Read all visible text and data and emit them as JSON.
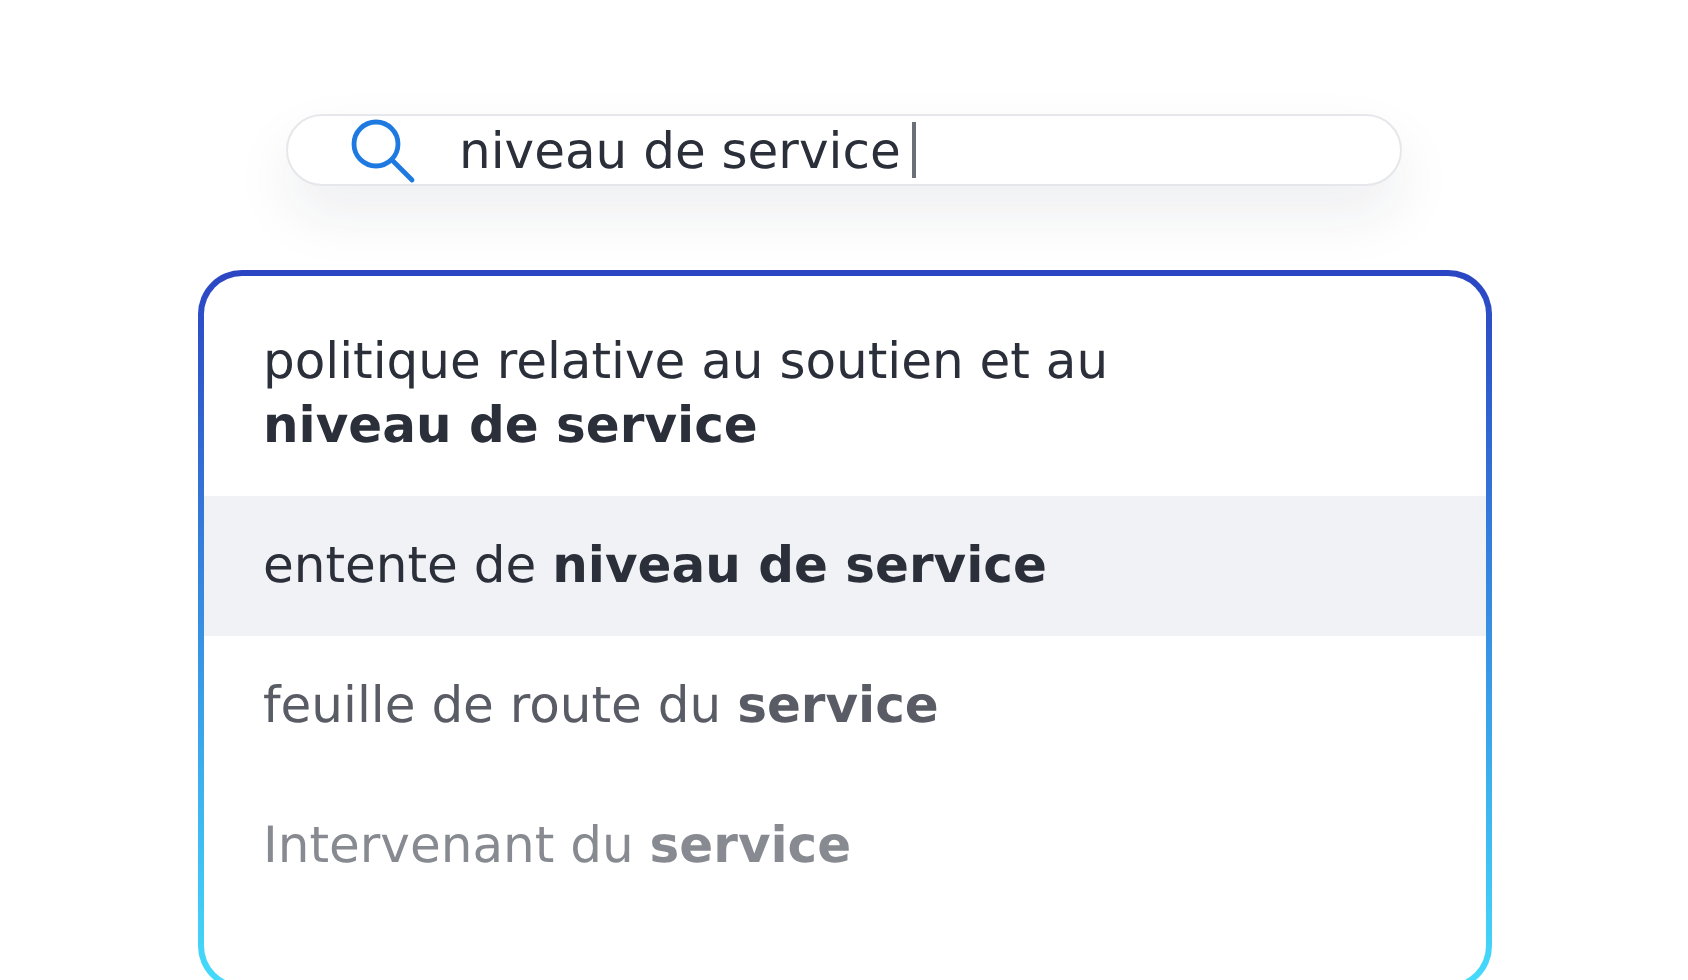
{
  "search": {
    "value": "niveau de service"
  },
  "suggestions": [
    {
      "text": "politique relative au soutien et au **niveau de service**",
      "selected": false
    },
    {
      "text": "entente de **niveau de service**",
      "selected": true
    },
    {
      "text": "feuille de route du **service**",
      "selected": false
    },
    {
      "text": "Intervenant  du **service**",
      "selected": false
    }
  ]
}
